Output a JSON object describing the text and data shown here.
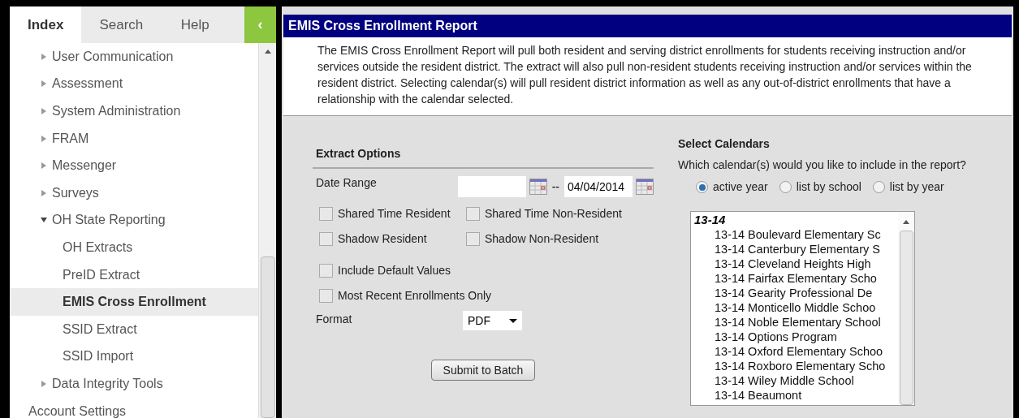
{
  "sidebar": {
    "tabs": [
      {
        "label": "Index",
        "selected": true
      },
      {
        "label": "Search",
        "selected": false
      },
      {
        "label": "Help",
        "selected": false
      }
    ],
    "collapse_button": "‹",
    "items": [
      {
        "label": "User Communication",
        "kind": "folder",
        "expanded": false
      },
      {
        "label": "Assessment",
        "kind": "folder",
        "expanded": false
      },
      {
        "label": "System Administration",
        "kind": "folder",
        "expanded": false
      },
      {
        "label": "FRAM",
        "kind": "folder",
        "expanded": false
      },
      {
        "label": "Messenger",
        "kind": "folder",
        "expanded": false
      },
      {
        "label": "Surveys",
        "kind": "folder",
        "expanded": false
      },
      {
        "label": "OH State Reporting",
        "kind": "folder",
        "expanded": true,
        "children": [
          {
            "label": "OH Extracts",
            "selected": false
          },
          {
            "label": "PreID Extract",
            "selected": false
          },
          {
            "label": "EMIS Cross Enrollment",
            "selected": true
          },
          {
            "label": "SSID Extract",
            "selected": false
          },
          {
            "label": "SSID Import",
            "selected": false
          }
        ]
      },
      {
        "label": "Data Integrity Tools",
        "kind": "folder",
        "expanded": false
      },
      {
        "label": "Account Settings",
        "kind": "link"
      }
    ]
  },
  "report": {
    "title": "EMIS Cross Enrollment Report",
    "description": "The EMIS Cross Enrollment Report will pull both resident and serving district enrollments for students receiving instruction and/or services outside the resident district. The extract will also pull non-resident students receiving instruction and/or services within the resident district. Selecting calendar(s) will pull resident district information as well as any out-of-district enrollments that have a relationship with the calendar selected."
  },
  "extract_options": {
    "title": "Extract Options",
    "date_range_label": "Date Range",
    "date_separator": "--",
    "end_date": "04/04/2014",
    "checkbox_rows": [
      [
        {
          "label": "Shared Time Resident",
          "checked": false
        },
        {
          "label": "Shared Time Non-Resident",
          "checked": false
        }
      ],
      [
        {
          "label": "Shadow Resident",
          "checked": false
        },
        {
          "label": "Shadow Non-Resident",
          "checked": false
        }
      ]
    ],
    "checkboxes": [
      {
        "label": "Include Default Values",
        "checked": false
      },
      {
        "label": "Most Recent Enrollments Only",
        "checked": false
      }
    ],
    "format_label": "Format",
    "format": "PDF",
    "submit_button": "Submit to Batch"
  },
  "calendars": {
    "title": "Select Calendars",
    "question": "Which calendar(s) would you like to include in the report?",
    "options": [
      {
        "label": "active year",
        "selected": true
      },
      {
        "label": "list by school",
        "selected": false
      },
      {
        "label": "list by year",
        "selected": false
      }
    ],
    "group": "13-14",
    "items": [
      "13-14 Boulevard Elementary Sc",
      "13-14 Canterbury Elementary S",
      "13-14 Cleveland Heights High",
      "13-14 Fairfax Elementary Scho",
      "13-14 Gearity Professional De",
      "13-14 Monticello Middle Schoo",
      "13-14 Noble Elementary School",
      "13-14 Options Program",
      "13-14 Oxford Elementary Schoo",
      "13-14 Roxboro Elementary Scho",
      "13-14 Wiley Middle School",
      "13-14 Beaumont"
    ]
  }
}
